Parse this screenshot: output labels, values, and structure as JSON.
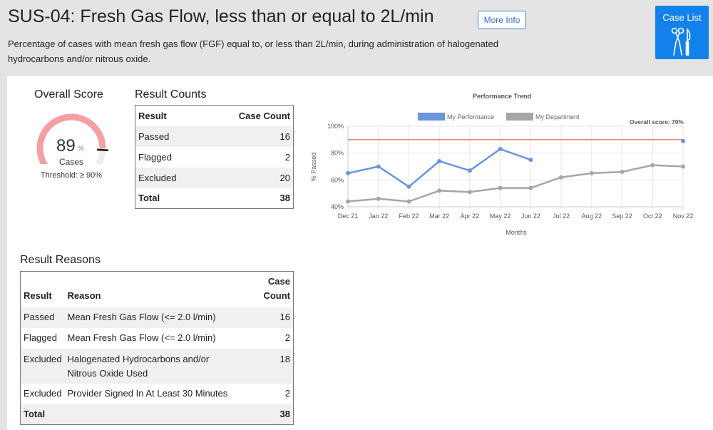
{
  "header": {
    "title": "SUS-04: Fresh Gas Flow, less than or equal to 2L/min",
    "more_info_label": "More Info",
    "description": "Percentage of cases with mean fresh gas flow (FGF) equal to, or less than 2L/min, during administration of halogenated hydrocarbons and/or nitrous oxide.",
    "case_list_label": "Case List",
    "case_list_icon": "surgical-instruments-icon"
  },
  "overall_score": {
    "title": "Overall Score",
    "value": "89",
    "unit": "%",
    "caption": "Cases",
    "threshold": "Threshold: ≥ 90%",
    "fraction": 0.89,
    "threshold_fraction": 0.9,
    "gauge_color": "#f4a0a3"
  },
  "result_counts": {
    "title": "Result Counts",
    "headers": [
      "Result",
      "Case Count"
    ],
    "rows": [
      {
        "result": "Passed",
        "count": "16"
      },
      {
        "result": "Flagged",
        "count": "2"
      },
      {
        "result": "Excluded",
        "count": "20"
      }
    ],
    "total": {
      "result": "Total",
      "count": "38"
    }
  },
  "result_reasons": {
    "title": "Result Reasons",
    "headers": [
      "Result",
      "Reason",
      "Case Count"
    ],
    "rows": [
      {
        "result": "Passed",
        "reason": "Mean Fresh Gas Flow (<= 2.0 l/min)",
        "count": "16"
      },
      {
        "result": "Flagged",
        "reason": "Mean Fresh Gas Flow (<= 2.0 l/min)",
        "count": "2"
      },
      {
        "result": "Excluded",
        "reason": "Halogenated Hydrocarbons and/or Nitrous Oxide Used",
        "count": "18"
      },
      {
        "result": "Excluded",
        "reason": "Provider Signed In At Least 30 Minutes",
        "count": "2"
      }
    ],
    "total": {
      "result": "Total",
      "count": "38"
    }
  },
  "chart_data": {
    "type": "line",
    "title": "Performance Trend",
    "xlabel": "Months",
    "ylabel": "% Passed",
    "categories": [
      "Dec 21",
      "Jan 22",
      "Feb 22",
      "Mar 22",
      "Apr 22",
      "May 22",
      "Jun 22",
      "Jul 22",
      "Aug 22",
      "Sep 22",
      "Oct 22",
      "Nov 22"
    ],
    "ylim": [
      40,
      100
    ],
    "yticks": [
      40,
      60,
      80,
      100
    ],
    "ytick_labels": [
      "40%",
      "60%",
      "80%",
      "100%"
    ],
    "legend_position": "top",
    "grid": true,
    "series": [
      {
        "name": "My Performance",
        "color": "#6a95dd",
        "values": [
          65,
          70,
          55,
          74,
          67,
          83,
          75,
          null,
          null,
          null,
          null,
          89
        ]
      },
      {
        "name": "My Department",
        "color": "#a6a6a6",
        "values": [
          44,
          46,
          44,
          52,
          51,
          54,
          54,
          62,
          65,
          66,
          71,
          70
        ]
      }
    ],
    "threshold": {
      "value": 90,
      "color": "#f07070"
    },
    "annotation": "Overall score: 70%"
  }
}
